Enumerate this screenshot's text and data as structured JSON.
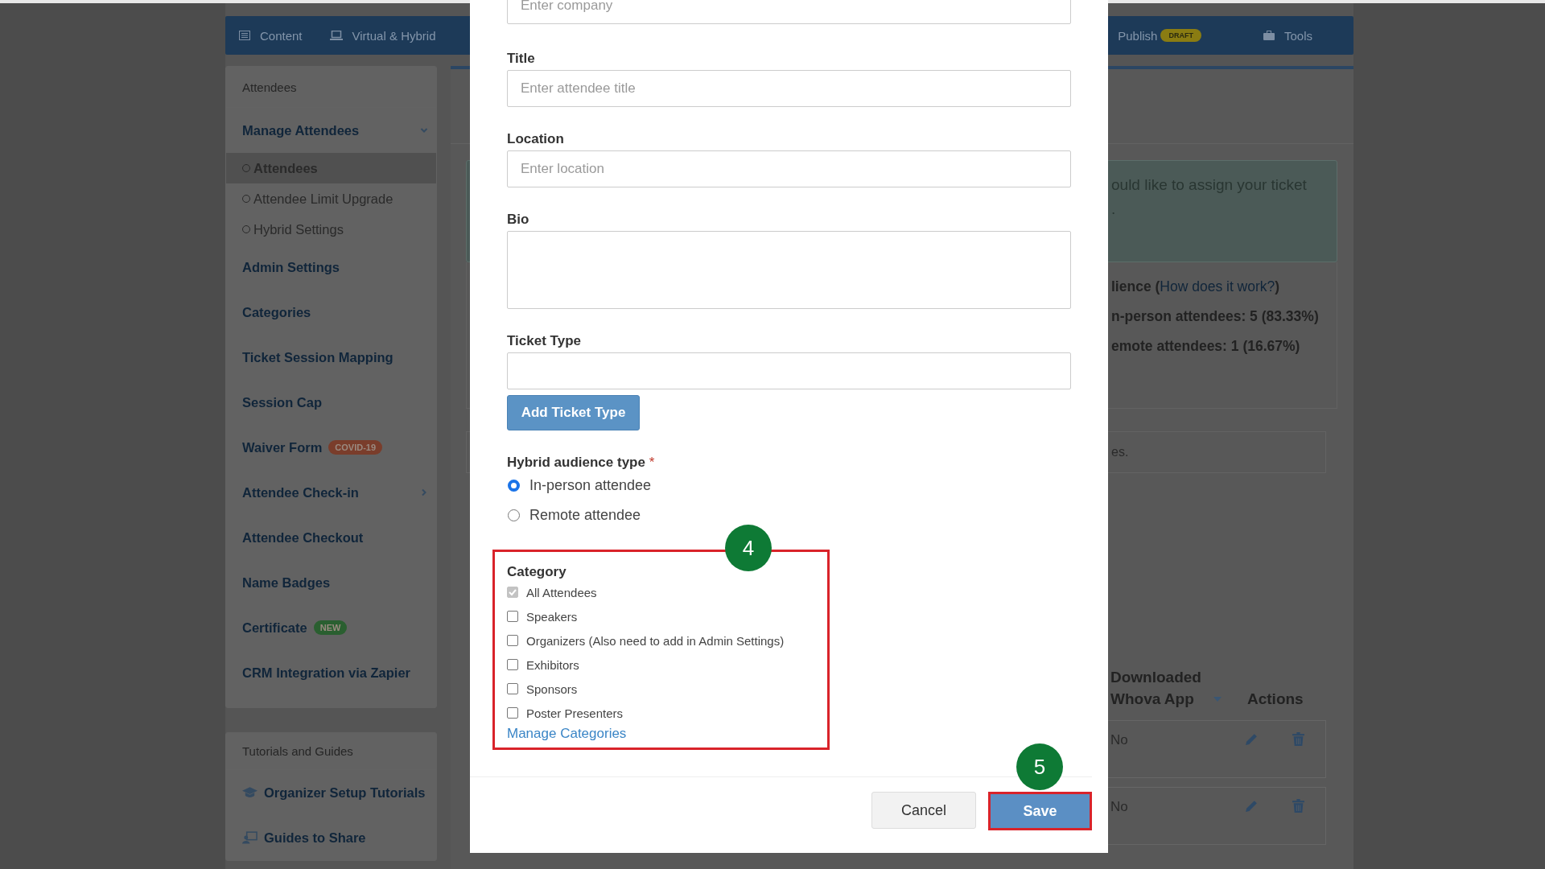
{
  "nav": {
    "left_tabs": [
      {
        "label": "Content"
      },
      {
        "label": "Virtual & Hybrid"
      }
    ],
    "right_tabs": [
      {
        "label": "Publish",
        "badge": "DRAFT"
      },
      {
        "label": "Tools"
      }
    ]
  },
  "sidebar": {
    "title": "Attendees",
    "items": [
      {
        "label": "Manage Attendees",
        "kind": "group",
        "expanded": true,
        "children": [
          {
            "label": "Attendees",
            "selected": true
          },
          {
            "label": "Attendee Limit Upgrade",
            "selected": false
          },
          {
            "label": "Hybrid Settings",
            "selected": false
          }
        ]
      },
      {
        "label": "Admin Settings",
        "kind": "link"
      },
      {
        "label": "Categories",
        "kind": "link"
      },
      {
        "label": "Ticket Session Mapping",
        "kind": "link"
      },
      {
        "label": "Session Cap",
        "kind": "link"
      },
      {
        "label": "Waiver Form",
        "kind": "link",
        "badge": {
          "text": "COVID-19",
          "color": "#7a3d2b"
        }
      },
      {
        "label": "Attendee Check-in",
        "kind": "group",
        "expanded": false
      },
      {
        "label": "Attendee Checkout",
        "kind": "link"
      },
      {
        "label": "Name Badges",
        "kind": "link"
      },
      {
        "label": "Certificate",
        "kind": "link",
        "badge": {
          "text": "NEW",
          "color": "#2a5f30"
        }
      },
      {
        "label": "CRM Integration via Zapier",
        "kind": "link"
      }
    ]
  },
  "guides": {
    "title": "Tutorials and Guides",
    "items": [
      {
        "label": "Organizer Setup Tutorials"
      },
      {
        "label": "Guides to Share"
      }
    ]
  },
  "alert": {
    "lines": [
      "ould like to assign your ticket",
      "."
    ]
  },
  "audience": {
    "title": "lience (",
    "link": "How does it work?",
    "title_end": ")",
    "stats": [
      "n-person attendees: 5 (83.33%)",
      "emote attendees: 1 (16.67%)"
    ]
  },
  "notice": "es.",
  "table": {
    "columns": [
      {
        "label": "Downloaded Whova App",
        "sortable": true
      },
      {
        "label": "Actions",
        "sortable": false
      }
    ],
    "rows": [
      {
        "downloaded": "No"
      },
      {
        "downloaded": "No"
      }
    ]
  },
  "modal": {
    "company_placeholder": "Enter company",
    "fields": [
      {
        "label": "Title",
        "kind": "input",
        "placeholder": "Enter attendee title"
      },
      {
        "label": "Location",
        "kind": "input",
        "placeholder": "Enter location"
      },
      {
        "label": "Bio",
        "kind": "textarea"
      },
      {
        "label": "Ticket Type",
        "kind": "input"
      }
    ],
    "add_button": "Add Ticket Type",
    "hybrid": {
      "label": "Hybrid audience type",
      "required_mark": "*",
      "options": [
        {
          "label": "In-person attendee",
          "selected": true
        },
        {
          "label": "Remote attendee",
          "selected": false
        }
      ]
    },
    "category": {
      "label": "Category",
      "highlighted": true,
      "step": "4",
      "options": [
        {
          "label": "All Attendees",
          "checked": true,
          "disabled": true
        },
        {
          "label": "Speakers",
          "checked": false,
          "disabled": false
        },
        {
          "label": "Organizers (Also need to add in Admin Settings)",
          "checked": false,
          "disabled": false
        },
        {
          "label": "Exhibitors",
          "checked": false,
          "disabled": false
        },
        {
          "label": "Sponsors",
          "checked": false,
          "disabled": false
        },
        {
          "label": "Poster Presenters",
          "checked": false,
          "disabled": false
        }
      ],
      "link": "Manage Categories"
    },
    "cancel": "Cancel",
    "save": {
      "label": "Save",
      "highlighted": true,
      "step": "5"
    }
  }
}
